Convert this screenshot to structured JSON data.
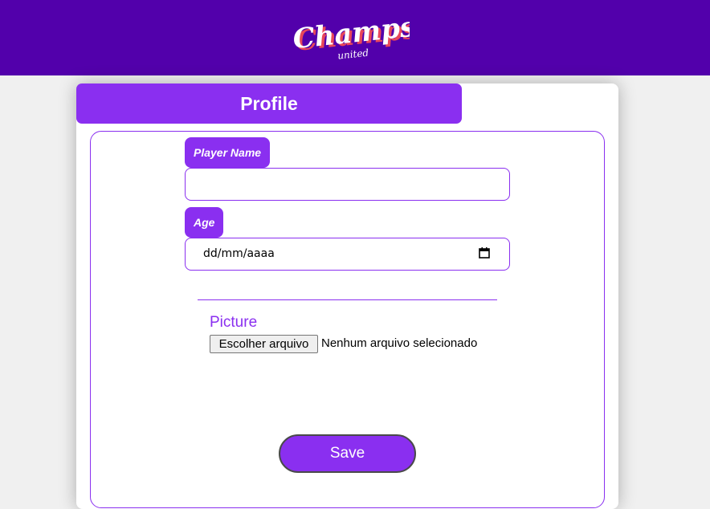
{
  "header": {
    "logo_text": "Champs",
    "logo_subtext": "united",
    "background_color": "#5200ab"
  },
  "profile": {
    "title": "Profile",
    "accent_color": "#8a2ff0"
  },
  "form": {
    "player_name_label": "Player Name",
    "player_name_value": "",
    "age_label": "Age",
    "age_value": "dd/mm/aaaa",
    "age_icon": "calendar-icon",
    "picture_label": "Picture",
    "file_button_label": "Escolher arquivo",
    "file_status": "Nenhum arquivo selecionado",
    "save_label": "Save"
  }
}
